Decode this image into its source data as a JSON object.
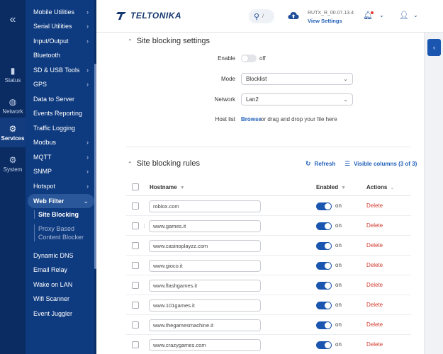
{
  "rail": {
    "items": [
      {
        "label": "Status",
        "icon": "signal-icon"
      },
      {
        "label": "Network",
        "icon": "globe-icon"
      },
      {
        "label": "Services",
        "icon": "gear-icon"
      },
      {
        "label": "System",
        "icon": "system-icon"
      }
    ]
  },
  "menu": {
    "items": [
      {
        "label": "Mobile Utilities",
        "chevron": "›"
      },
      {
        "label": "Serial Utilities",
        "chevron": "›"
      },
      {
        "label": "Input/Output",
        "chevron": "›"
      },
      {
        "label": "Bluetooth",
        "chevron": ""
      },
      {
        "label": "SD & USB Tools",
        "chevron": "›"
      },
      {
        "label": "GPS",
        "chevron": "›"
      },
      {
        "label": "Data to Server",
        "chevron": ""
      },
      {
        "label": "Events Reporting",
        "chevron": ""
      },
      {
        "label": "Traffic Logging",
        "chevron": ""
      },
      {
        "label": "Modbus",
        "chevron": "›"
      },
      {
        "label": "MQTT",
        "chevron": "›"
      },
      {
        "label": "SNMP",
        "chevron": "›"
      },
      {
        "label": "Hotspot",
        "chevron": "›"
      },
      {
        "label": "Web Filter",
        "chevron": "⌄"
      }
    ],
    "sub_items": [
      {
        "label": "Site Blocking"
      },
      {
        "label_line1": "Proxy Based",
        "label_line2": "Content Blocker"
      }
    ],
    "items_after": [
      {
        "label": "Dynamic DNS"
      },
      {
        "label": "Email Relay"
      },
      {
        "label": "Wake on LAN"
      },
      {
        "label": "Wifi Scanner"
      },
      {
        "label": "Event Juggler"
      }
    ]
  },
  "header": {
    "logo": "TELTONIKA",
    "search_slash": "/",
    "firmware": "RUTX_R_00.07.13.4",
    "view_settings": "View Settings"
  },
  "settings": {
    "title": "Site blocking settings",
    "enable_label": "Enable",
    "enable_state": "off",
    "mode_label": "Mode",
    "mode_value": "Blocklist",
    "network_label": "Network",
    "network_value": "Lan2",
    "hostlist_label": "Host list",
    "browse": "Browse",
    "drop_text": "or drag and drop your file here"
  },
  "rules": {
    "title": "Site blocking rules",
    "refresh": "Refresh",
    "visible_columns": "Visible columns (3 of 3)",
    "columns": {
      "hostname": "Hostname",
      "enabled": "Enabled",
      "actions": "Actions"
    },
    "rows": [
      {
        "host": "roblox.com",
        "state": "on",
        "action": "Delete"
      },
      {
        "host": "www.games.it",
        "state": "on",
        "action": "Delete"
      },
      {
        "host": "www.casinoplayzz.com",
        "state": "on",
        "action": "Delete"
      },
      {
        "host": "www.gioco.it",
        "state": "on",
        "action": "Delete"
      },
      {
        "host": "www.flashgames.it",
        "state": "on",
        "action": "Delete"
      },
      {
        "host": "www.101games.it",
        "state": "on",
        "action": "Delete"
      },
      {
        "host": "www.thegamesmachine.it",
        "state": "on",
        "action": "Delete"
      },
      {
        "host": "www.crazygames.com",
        "state": "on",
        "action": "Delete"
      }
    ]
  },
  "colors": {
    "navy": "#0a2c63",
    "menu": "#0e3a7f",
    "accent": "#1a56b0",
    "danger": "#d23b2f"
  }
}
